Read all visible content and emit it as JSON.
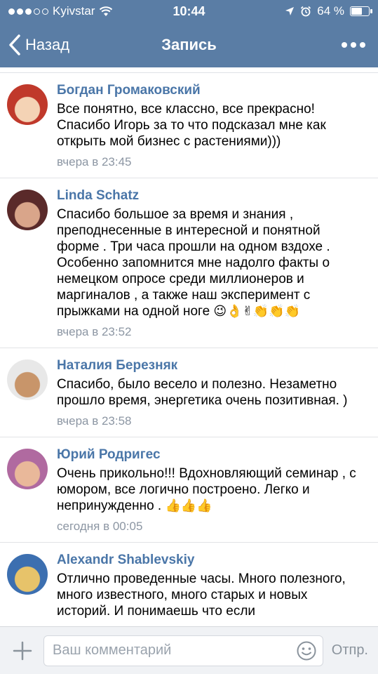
{
  "status": {
    "carrier": "Kyivstar",
    "time": "10:44",
    "battery": "64 %",
    "battery_level": 0.64
  },
  "nav": {
    "back_label": "Назад",
    "title": "Запись"
  },
  "comments": [
    {
      "author": "Богдан Громаковский",
      "text": "Все понятно, все классно, все прекрасно! Спасибо Игорь за то что подсказал мне как открыть мой бизнес с растениями)))",
      "emoji": "",
      "time": "вчера в 23:45",
      "avatar_colors": [
        "#c0392b",
        "#f4d3b5"
      ]
    },
    {
      "author": "Linda Schatz",
      "text": "Спасибо большое за время и знания , преподнесенные в интересной и понятной форме . Три часа прошли на одном вздохе . Особенно запомнится мне надолго факты о немецком опросе среди миллионеров и маргиналов , а также наш эксперимент с прыжками на одной ноге",
      "emoji": "😉👌✌👏👏👏",
      "time": "вчера в 23:52",
      "avatar_colors": [
        "#5a2a2a",
        "#d9a58a"
      ]
    },
    {
      "author": "Наталия Березняк",
      "text": "Спасибо, было весело и полезно. Незаметно прошло время, энергетика очень позитивная. )",
      "emoji": "",
      "time": "вчера в 23:58",
      "avatar_colors": [
        "#e8e8e8",
        "#c8956a"
      ]
    },
    {
      "author": "Юрий Родригес",
      "text": "Очень прикольно!!! Вдохновляющий семинар , с юмором, все логично построено. Легко и непринужденно .",
      "emoji": "👍👍👍",
      "time": "сегодня в 00:05",
      "avatar_colors": [
        "#b06aa0",
        "#e9b89a"
      ]
    },
    {
      "author": "Alexandr Shablevskiy",
      "text": "Отлично проведенные часы. Много полезного, много известного, много старых и новых историй. И понимаешь что если",
      "emoji": "",
      "time": "",
      "avatar_colors": [
        "#3c6fb0",
        "#e7c36a"
      ]
    }
  ],
  "composer": {
    "placeholder": "Ваш комментарий",
    "send_label": "Отпр."
  }
}
